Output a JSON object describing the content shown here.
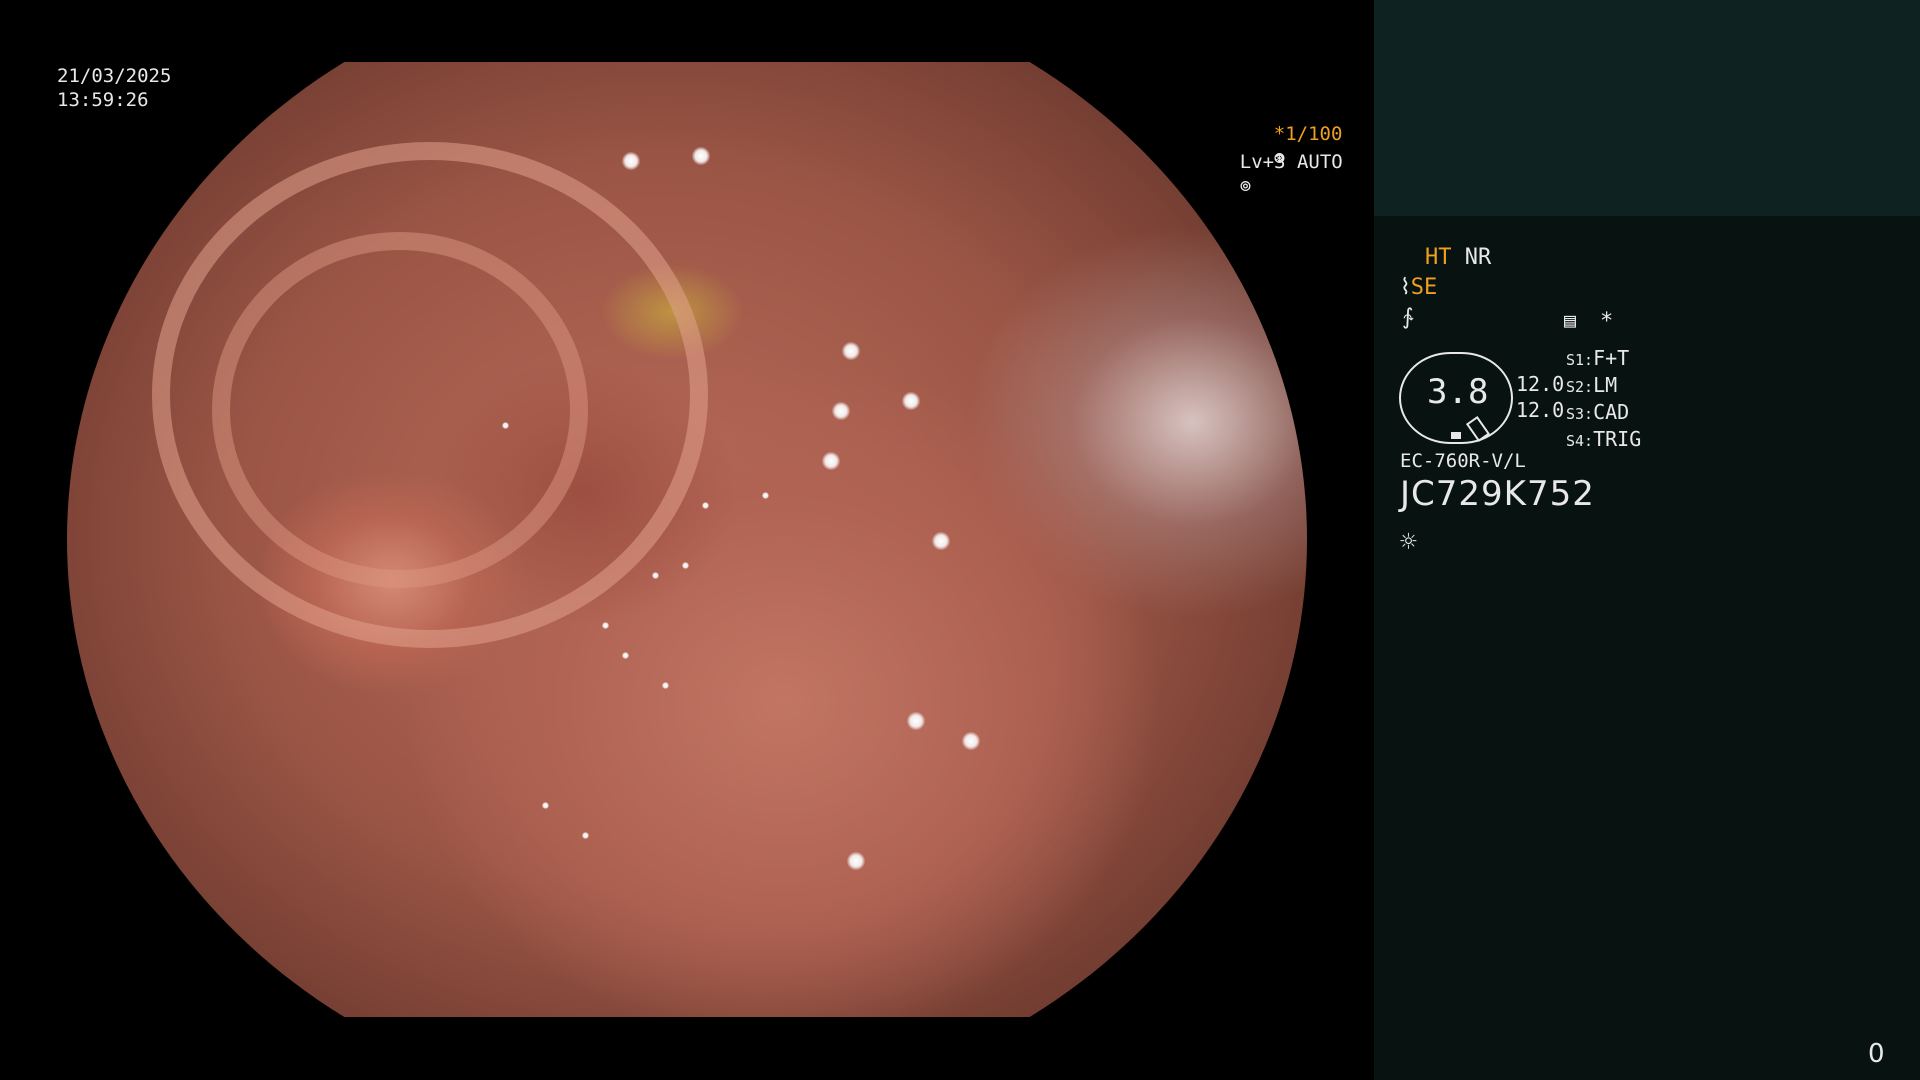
{
  "overlay": {
    "date": "21/03/2025",
    "time": "13:59:26",
    "shutter": "*1/100",
    "shutter_icon": "shutter-icon",
    "level": "Lv+3 AUTO",
    "level_icon": "auto-iris-icon"
  },
  "panel": {
    "ht": "HT",
    "nr": "NR",
    "se": "SE",
    "se_icon": "structure-enhance-icon",
    "color_icon": "color-mode-icon",
    "settings_icon": "settings-list-icon",
    "star": "*",
    "zoom_value": "3.8",
    "values": [
      "12.0",
      "12.0"
    ],
    "switches": [
      {
        "key": "S1:",
        "label": "F+T"
      },
      {
        "key": "S2:",
        "label": "LM"
      },
      {
        "key": "S3:",
        "label": "CAD"
      },
      {
        "key": "S4:",
        "label": "TRIG"
      }
    ],
    "model": "EC-760R-V/L",
    "serial": "JC729K752",
    "light_icon": "light-source-icon",
    "corner_number": "0"
  },
  "colors": {
    "accent": "#f0a020",
    "panel_top": "#0e2222",
    "panel": "#071211"
  }
}
